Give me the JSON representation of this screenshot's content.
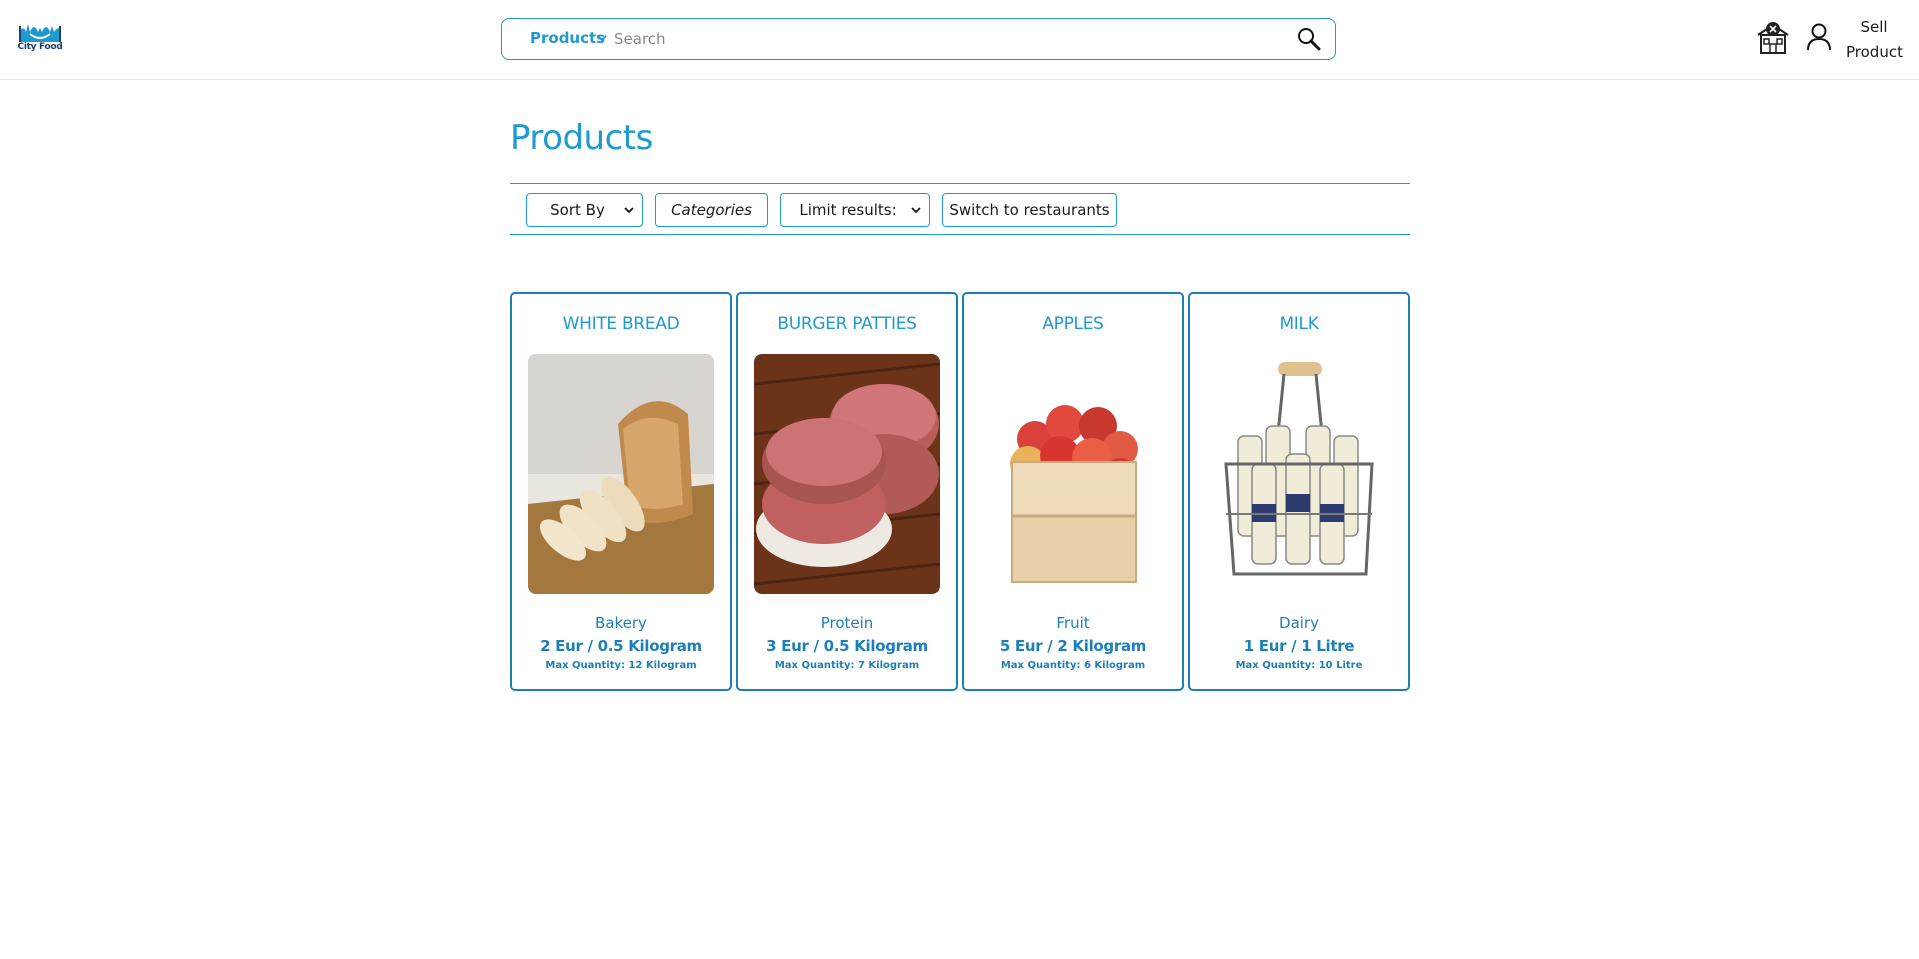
{
  "header": {
    "logo_text": "City Food",
    "search_scope": "Products",
    "search_placeholder": "Search",
    "sell_label_line1": "Sell",
    "sell_label_line2": "Product",
    "icons": [
      "city-food-logo",
      "chevron-down-icon",
      "magnifier-icon",
      "restaurant-icon",
      "user-icon"
    ]
  },
  "main": {
    "title": "Products",
    "filters": {
      "sort_label": "Sort By",
      "categories_label": "Categories",
      "limit_label": "Limit results:",
      "switch_label": "Switch to restaurants"
    },
    "products": [
      {
        "name": "WHITE BREAD",
        "category": "Bakery",
        "price": "2 Eur / 0.5 Kilogram",
        "max": "Max Quantity: 12 Kilogram",
        "image": "bread-loaf-on-board"
      },
      {
        "name": "BURGER PATTIES",
        "category": "Protein",
        "price": "3 Eur / 0.5 Kilogram",
        "max": "Max Quantity: 7 Kilogram",
        "image": "raw-burger-patties"
      },
      {
        "name": "APPLES",
        "category": "Fruit",
        "price": "5 Eur / 2 Kilogram",
        "max": "Max Quantity: 6 Kilogram",
        "image": "apples-in-crate"
      },
      {
        "name": "MILK",
        "category": "Dairy",
        "price": "1 Eur / 1 Litre",
        "max": "Max Quantity: 10 Litre",
        "image": "milk-bottles-in-carrier"
      }
    ]
  },
  "colors": {
    "accent": "#1d9bd1",
    "accent_dark": "#1d7fb8",
    "border": "#e3e3e3"
  }
}
